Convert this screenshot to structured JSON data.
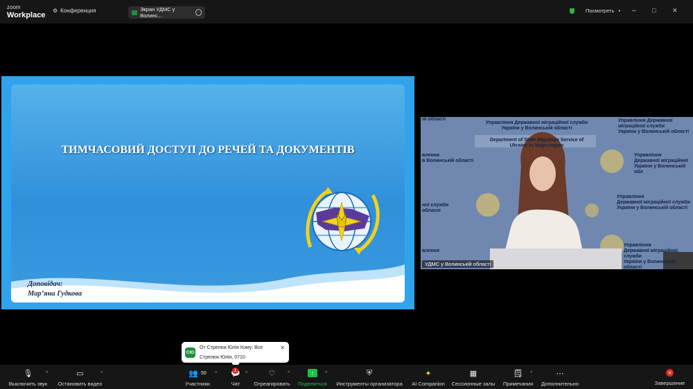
{
  "titlebar": {
    "logo_top": "zoom",
    "logo_bottom": "Workplace",
    "conference_label": "Конференция",
    "share_tab_label": "Экран УДМС у Волинс...",
    "view_label": "Посмотреть",
    "minimize": "–",
    "maximize": "□",
    "close": "✕"
  },
  "slide": {
    "title": "ТИМЧАСОВИЙ ДОСТУП ДО РЕЧЕЙ ТА ДОКУМЕНТІВ",
    "speaker_label": "Доповідач:",
    "speaker_name": "Мар’яна Гудкова"
  },
  "video": {
    "banner_ua_1": "Управління Державної міграційної служби",
    "banner_ua_2": "України у Волинській області",
    "banner_en_1": "Department of State Migration Service of",
    "banner_en_2": "Ukraine in Volyn region",
    "left_1": "влення",
    "left_2": "в Волинській області",
    "left_3": "ної служби",
    "left_4": "обласні",
    "top_left": "ій області",
    "right_1": "Управління Державної міграційної служби",
    "right_2": "України у Волинській області",
    "right_mid_1": "Управління",
    "right_mid_2": "Державної міграційної служби",
    "right_mid_3": "України у Волинській області",
    "right_low_1": "Управління",
    "right_low_2": "Державної міграційної служби",
    "right_low_3": "України у Волинській області",
    "right_top_1": "Управління",
    "right_top_2": "Державної міграційної",
    "right_top_3": "України у Волинській обл",
    "bottom_left": "влення",
    "participant_name": "УДМС у Волинській області"
  },
  "notification": {
    "avatar": "СЮ",
    "line1": "От Стрелюк Юлія Кому: Все",
    "line2": "Стрелюк Юлія, 0710",
    "close": "✕"
  },
  "toolbar": {
    "mute": "Выключить звук",
    "video": "Остановить видео",
    "participants": "Участники",
    "participants_count": "50",
    "chat": "Чат",
    "chat_badge": "1",
    "react": "Отреагировать",
    "share": "Поделиться",
    "host_tools": "Инструменты организатора",
    "ai": "AI Companion",
    "breakout": "Сессионные залы",
    "notes": "Примечания",
    "more": "Дополнительно",
    "end": "Завершение"
  },
  "colors": {
    "share_green": "#1fbf4c",
    "end_red": "#e0261f",
    "slide_blue": "#2fa4ec"
  }
}
